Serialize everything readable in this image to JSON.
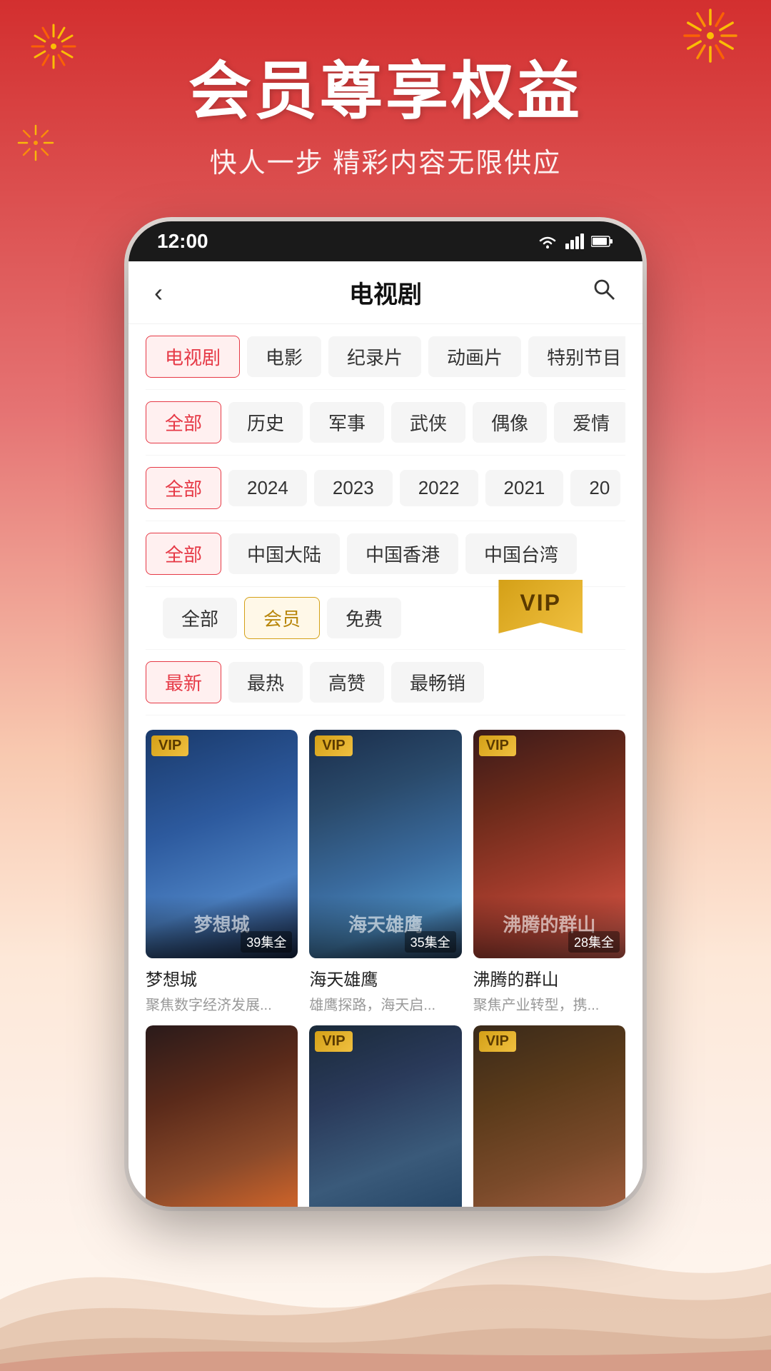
{
  "background": {
    "gradient_start": "#d32f2f",
    "gradient_end": "#fff8f0"
  },
  "hero": {
    "title": "会员尊享权益",
    "subtitle": "快人一步  精彩内容无限供应"
  },
  "status_bar": {
    "time": "12:00",
    "icons": [
      "wifi",
      "signal",
      "battery"
    ]
  },
  "nav": {
    "title": "电视剧",
    "back_icon": "‹",
    "search_icon": "🔍"
  },
  "filter_rows": [
    {
      "id": "category",
      "items": [
        {
          "label": "电视剧",
          "active": true,
          "style": "active-red"
        },
        {
          "label": "电影",
          "active": false,
          "style": ""
        },
        {
          "label": "纪录片",
          "active": false,
          "style": ""
        },
        {
          "label": "动画片",
          "active": false,
          "style": ""
        },
        {
          "label": "特别节目",
          "active": false,
          "style": ""
        }
      ]
    },
    {
      "id": "genre",
      "items": [
        {
          "label": "全部",
          "active": true,
          "style": "active-red"
        },
        {
          "label": "历史",
          "active": false,
          "style": ""
        },
        {
          "label": "军事",
          "active": false,
          "style": ""
        },
        {
          "label": "武侠",
          "active": false,
          "style": ""
        },
        {
          "label": "偶像",
          "active": false,
          "style": ""
        },
        {
          "label": "爱情",
          "active": false,
          "style": ""
        }
      ]
    },
    {
      "id": "year",
      "items": [
        {
          "label": "全部",
          "active": true,
          "style": "active-red"
        },
        {
          "label": "2024",
          "active": false,
          "style": ""
        },
        {
          "label": "2023",
          "active": false,
          "style": ""
        },
        {
          "label": "2022",
          "active": false,
          "style": ""
        },
        {
          "label": "2021",
          "active": false,
          "style": ""
        },
        {
          "label": "20...",
          "active": false,
          "style": ""
        }
      ]
    },
    {
      "id": "region",
      "items": [
        {
          "label": "全部",
          "active": true,
          "style": "active-red"
        },
        {
          "label": "中国大陆",
          "active": false,
          "style": ""
        },
        {
          "label": "中国香港",
          "active": false,
          "style": ""
        },
        {
          "label": "中国台湾",
          "active": false,
          "style": ""
        }
      ]
    },
    {
      "id": "membership",
      "items": [
        {
          "label": "全部",
          "active": false,
          "style": ""
        },
        {
          "label": "会员",
          "active": true,
          "style": "active-gold"
        },
        {
          "label": "免费",
          "active": false,
          "style": ""
        }
      ]
    },
    {
      "id": "sort",
      "items": [
        {
          "label": "最新",
          "active": true,
          "style": "active-red"
        },
        {
          "label": "最热",
          "active": false,
          "style": ""
        },
        {
          "label": "高赞",
          "active": false,
          "style": ""
        },
        {
          "label": "最畅销",
          "active": false,
          "style": ""
        }
      ]
    }
  ],
  "vip_tag": "VIP",
  "cards": [
    {
      "id": 1,
      "title": "梦想城",
      "desc": "聚焦数字经济发展...",
      "badge": "VIP",
      "episodes": "39集全",
      "thumb_class": "thumb-1",
      "thumb_text": "梦想城"
    },
    {
      "id": 2,
      "title": "海天雄鹰",
      "desc": "雄鹰探路，海天启...",
      "badge": "VIP",
      "episodes": "35集全",
      "thumb_class": "thumb-2",
      "thumb_text": "海天雄鹰"
    },
    {
      "id": 3,
      "title": "沸腾的群山",
      "desc": "聚焦产业转型，携...",
      "badge": "VIP",
      "episodes": "28集全",
      "thumb_class": "thumb-3",
      "thumb_text": "沸腾的群山"
    },
    {
      "id": 4,
      "title": "",
      "desc": "",
      "badge": "",
      "episodes": "",
      "thumb_class": "thumb-4",
      "thumb_text": ""
    },
    {
      "id": 5,
      "title": "",
      "desc": "",
      "badge": "VIP",
      "episodes": "",
      "thumb_class": "thumb-5",
      "thumb_text": ""
    },
    {
      "id": 6,
      "title": "",
      "desc": "",
      "badge": "VIP",
      "episodes": "",
      "thumb_class": "thumb-6",
      "thumb_text": ""
    }
  ]
}
